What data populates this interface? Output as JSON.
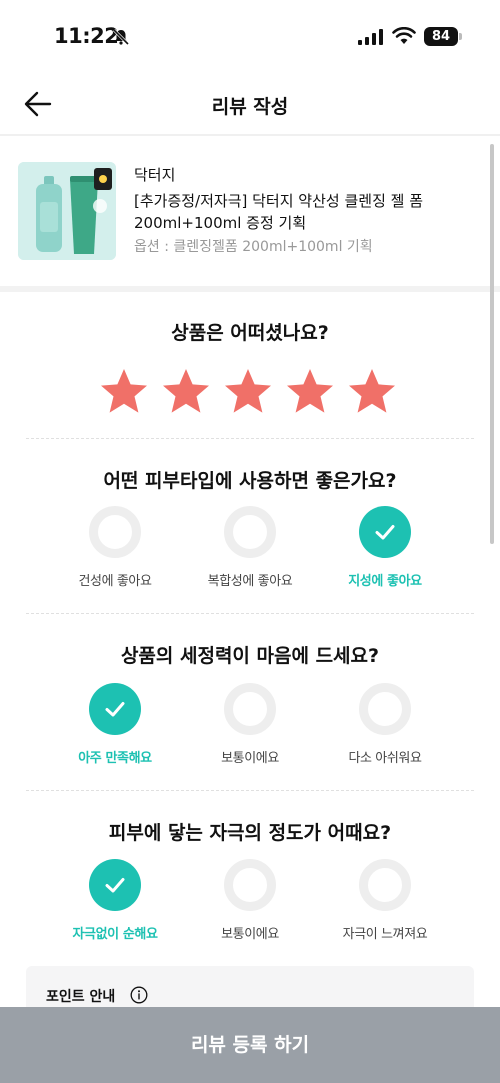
{
  "status_bar": {
    "time": "11:22",
    "battery": "84"
  },
  "header": {
    "title": "리뷰 작성"
  },
  "product": {
    "brand": "닥터지",
    "name": "[추가증정/저자극] 닥터지 약산성 클렌징 젤 폼 200ml+100ml 증정 기획",
    "option": "옵션 : 클렌징젤폼 200ml+100ml 기획"
  },
  "rating": {
    "question": "상품은 어떠셨나요?",
    "value": 5,
    "max": 5,
    "star_color": "#f07068"
  },
  "questions": [
    {
      "title": "어떤 피부타입에 사용하면 좋은가요?",
      "options": [
        "건성에 좋아요",
        "복합성에 좋아요",
        "지성에 좋아요"
      ],
      "selected": 2
    },
    {
      "title": "상품의 세정력이 마음에 드세요?",
      "options": [
        "아주 만족해요",
        "보통이에요",
        "다소 아쉬워요"
      ],
      "selected": 0
    },
    {
      "title": "피부에 닿는 자극의 정도가 어때요?",
      "options": [
        "자극없이 순해요",
        "보통이에요",
        "자극이 느껴져요"
      ],
      "selected": 0
    }
  ],
  "point_notice": {
    "title": "포인트 안내"
  },
  "submit": {
    "label": "리뷰 등록 하기"
  },
  "colors": {
    "accent": "#1dc1b2",
    "submit_bg": "#9aa0a7"
  }
}
